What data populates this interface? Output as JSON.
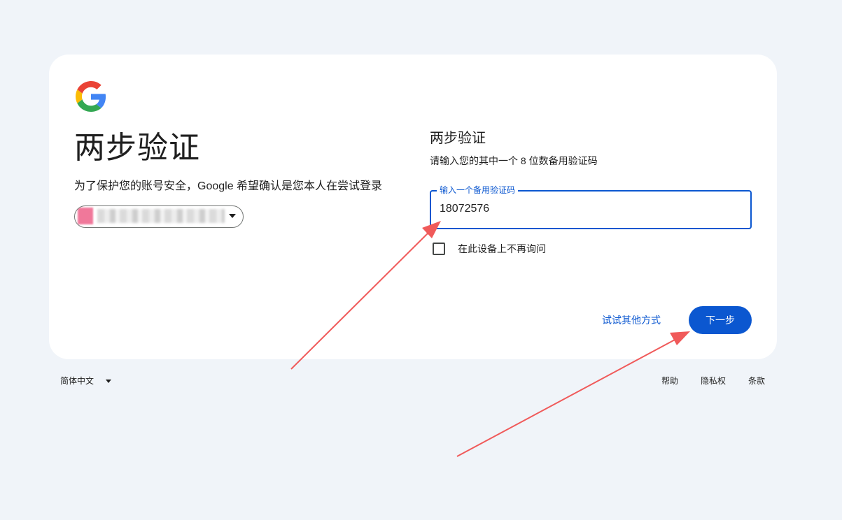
{
  "header": {
    "logo_icon": "google-g-logo",
    "title": "两步验证",
    "subtitle": "为了保护您的账号安全，Google 希望确认是您本人在尝试登录"
  },
  "account_chip": {
    "email": "(blurred)",
    "icon": "chevron-down-icon"
  },
  "main": {
    "section_title": "两步验证",
    "instruction": "请输入您的其中一个 8 位数备用验证码",
    "field_label": "输入一个备用验证码",
    "field_value": "18072576",
    "checkbox_label": "在此设备上不再询问",
    "checkbox_checked": false,
    "try_other_label": "试试其他方式",
    "next_label": "下一步"
  },
  "footer": {
    "language": "简体中文",
    "links": [
      "帮助",
      "隐私权",
      "条款"
    ]
  },
  "colors": {
    "background": "#f0f4f9",
    "card": "#ffffff",
    "accent": "#0b57d0",
    "annotation": "#f05a5a"
  }
}
